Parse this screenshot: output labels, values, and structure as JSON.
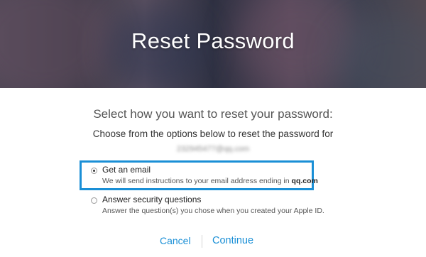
{
  "header": {
    "title": "Reset Password"
  },
  "main": {
    "subtitle": "Select how you want to reset your password:",
    "instruction": "Choose from the options below to reset the password for",
    "account_blurred": "232945477@qq.com",
    "options": [
      {
        "label": "Get an email",
        "description_prefix": "We will send instructions to your email address ending in",
        "description_domain": "qq.com",
        "selected": true
      },
      {
        "label": "Answer security questions",
        "description": "Answer the question(s) you chose when you created your Apple ID.",
        "selected": false
      }
    ]
  },
  "actions": {
    "cancel_label": "Cancel",
    "continue_label": "Continue"
  },
  "colors": {
    "accent": "#1a8fd6",
    "highlight_border": "#1a8fd6"
  }
}
